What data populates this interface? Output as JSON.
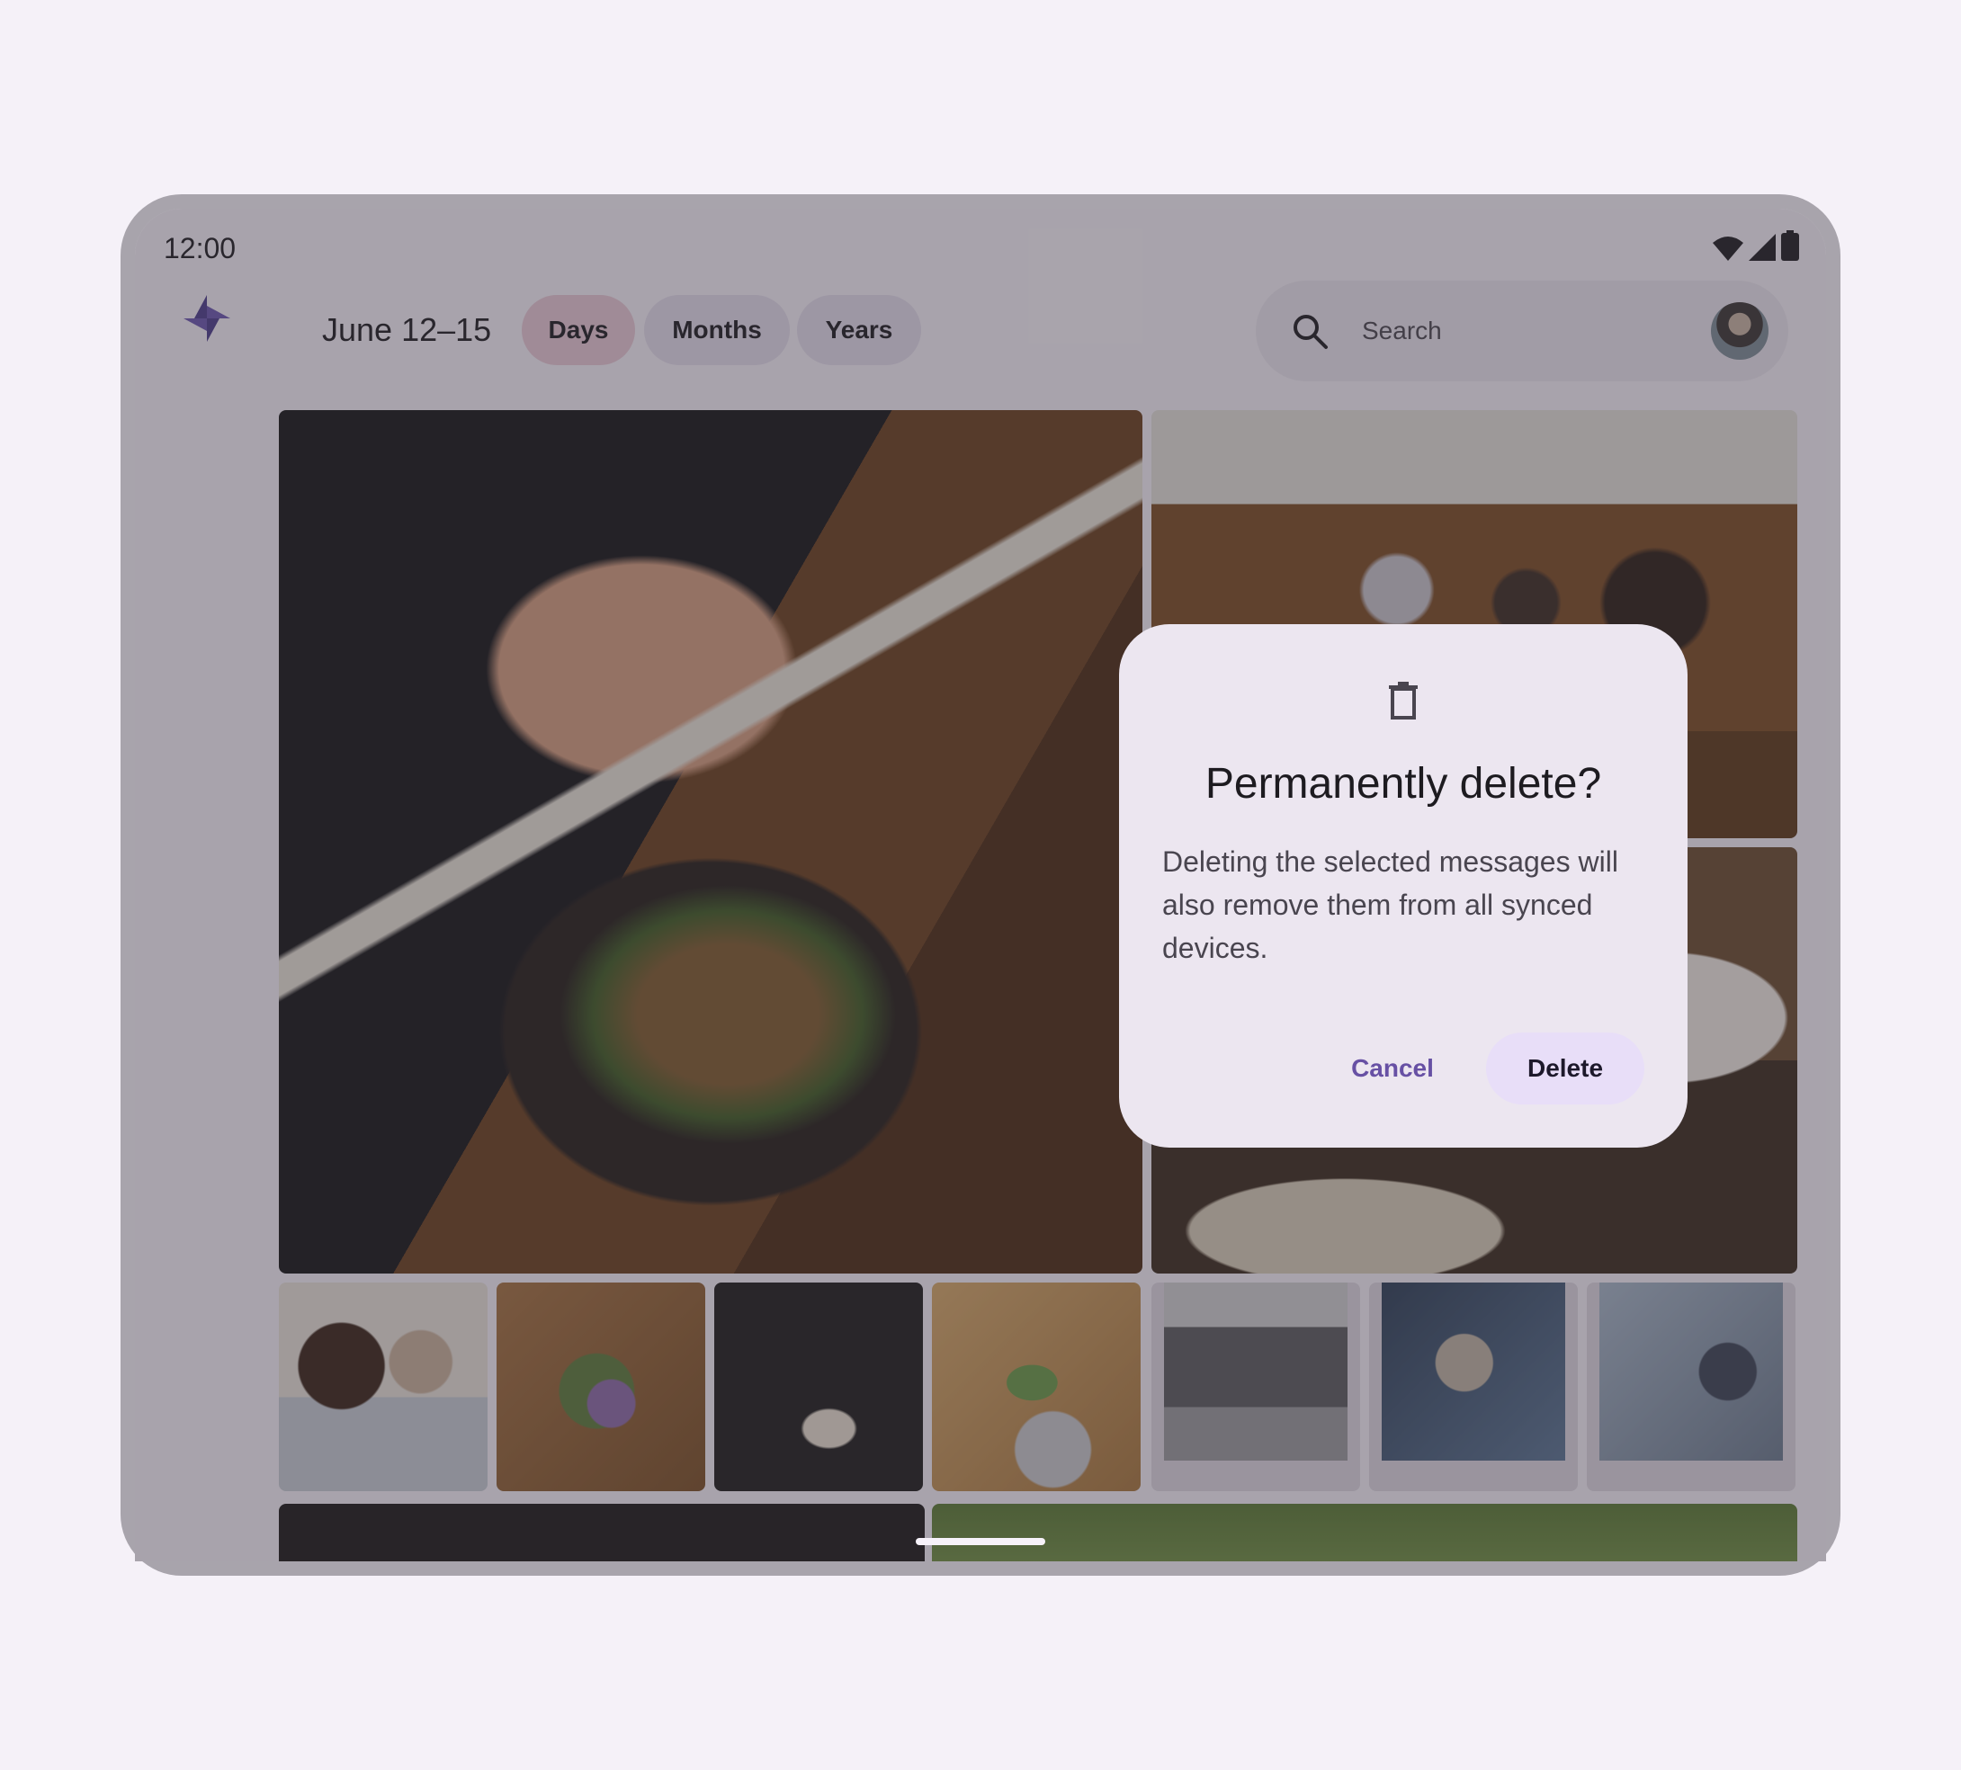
{
  "status_bar": {
    "time": "12:00",
    "icons": [
      "wifi-icon",
      "signal-icon",
      "battery-icon"
    ]
  },
  "app_bar": {
    "logo_icon": "pinwheel-logo-icon",
    "date_range": "June 12–15",
    "chips": [
      {
        "label": "Days",
        "selected": true
      },
      {
        "label": "Months",
        "selected": false
      },
      {
        "label": "Years",
        "selected": false
      }
    ],
    "search": {
      "placeholder": "Search",
      "icon": "search-icon"
    }
  },
  "dialog": {
    "icon": "trash-icon",
    "title": "Permanently delete?",
    "body": "Deleting the selected messages will also remove them from all synced devices.",
    "cancel_label": "Cancel",
    "confirm_label": "Delete"
  },
  "colors": {
    "primary": "#6750a4",
    "selected_chip": "#e8c9d6",
    "chip": "#e4dcec",
    "dialog_surface": "#ece6f0",
    "tonal_button": "#e8def8"
  }
}
